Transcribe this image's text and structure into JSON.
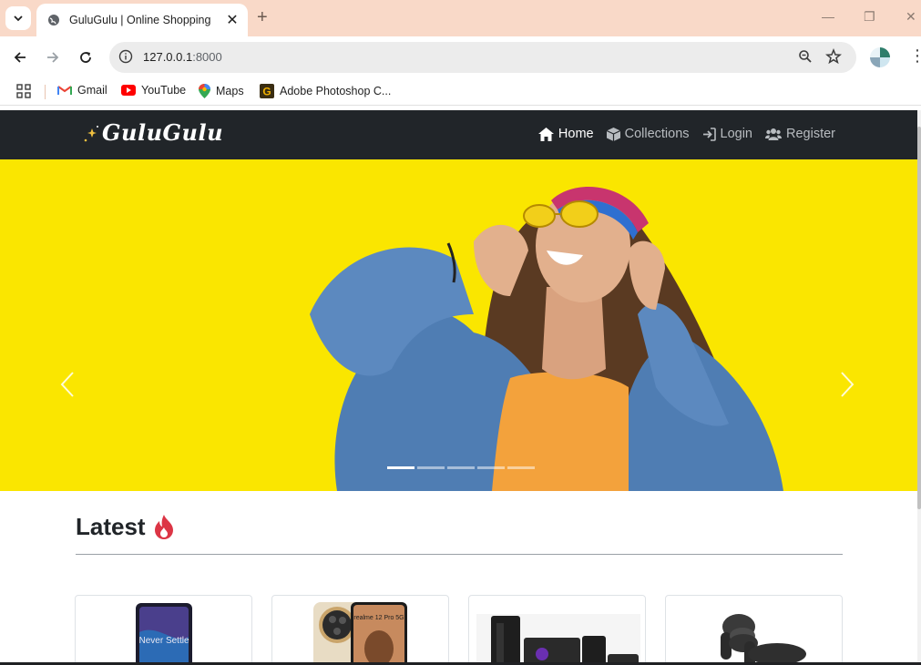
{
  "browser": {
    "tab_title": "GuluGulu | Online Shopping",
    "url_host": "127.0.0.1",
    "url_port": ":8000",
    "bookmarks": [
      "Gmail",
      "YouTube",
      "Maps",
      "Adobe Photoshop C..."
    ]
  },
  "site": {
    "brand": "GuluGulu",
    "nav": [
      {
        "label": "Home",
        "icon": "home-icon",
        "active": true
      },
      {
        "label": "Collections",
        "icon": "box-icon",
        "active": false
      },
      {
        "label": "Login",
        "icon": "login-icon",
        "active": false
      },
      {
        "label": "Register",
        "icon": "users-icon",
        "active": false
      }
    ],
    "carousel": {
      "slide_count": 5,
      "active_index": 0
    }
  },
  "main": {
    "section_title": "Latest",
    "section_icon": "fire-icon",
    "products": [
      {
        "image": "oneplus-phone",
        "image_text": "Never Settle"
      },
      {
        "image": "realme-phone",
        "image_text": "realme 12 Pro 5G"
      },
      {
        "image": "home-theater-speakers",
        "image_text": ""
      },
      {
        "image": "wireless-earbuds",
        "image_text": ""
      }
    ]
  },
  "colors": {
    "chrome_tab_strip": "#f9d9c8",
    "navbar": "#212529",
    "hero_background": "#fae600",
    "fire_accent": "#dc3545"
  }
}
